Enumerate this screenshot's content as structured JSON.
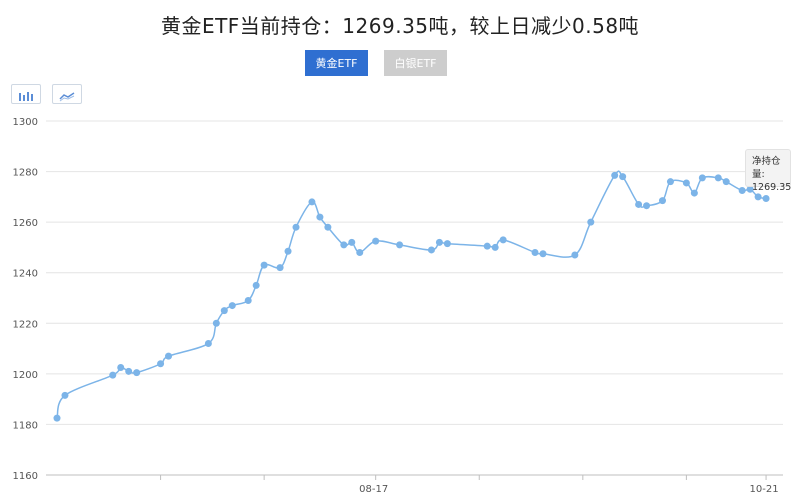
{
  "title": "黄金ETF当前持仓：1269.35吨，较上日减少0.58吨",
  "tabs": [
    {
      "label": "黄金ETF",
      "active": true,
      "color": "#2f6fd1"
    },
    {
      "label": "白银ETF",
      "active": false,
      "color": "#cdcdcd"
    }
  ],
  "view_toggle": {
    "bar_icon": "bar-chart-icon",
    "line_icon": "line-chart-icon"
  },
  "tooltip": {
    "label": "净持仓量:",
    "value": "1269.35"
  },
  "chart_data": {
    "type": "line",
    "ylim": [
      1160,
      1300
    ],
    "yticks": [
      1160,
      1180,
      1200,
      1220,
      1240,
      1260,
      1280,
      1300
    ],
    "xtick_labels": [
      "08-17",
      "10-21"
    ],
    "line_color": "#7cb4e8",
    "grid": true,
    "series": [
      {
        "x": [
          0,
          1,
          7,
          8,
          9,
          10,
          13,
          14,
          19,
          20,
          21,
          22,
          24,
          25,
          26,
          28,
          29,
          30,
          32,
          33,
          34,
          36,
          37,
          38,
          40,
          43,
          47,
          48,
          49,
          54,
          55,
          56,
          60,
          61,
          65,
          67,
          70,
          71,
          73,
          74,
          76,
          77,
          79,
          80,
          81,
          83,
          84,
          86,
          87,
          88,
          89
        ],
        "values": [
          1182.5,
          1191.5,
          1199.5,
          1202.5,
          1201.0,
          1200.5,
          1204.0,
          1207.0,
          1212.0,
          1220.0,
          1225.0,
          1227.0,
          1229.0,
          1235.0,
          1243.0,
          1242.0,
          1248.5,
          1258.0,
          1268.0,
          1262.0,
          1258.0,
          1251.0,
          1252.0,
          1248.0,
          1252.5,
          1251.0,
          1249.0,
          1252.0,
          1251.5,
          1250.5,
          1250.0,
          1253.0,
          1248.0,
          1247.5,
          1247.0,
          1260.0,
          1278.5,
          1278.0,
          1267.0,
          1266.5,
          1268.5,
          1276.0,
          1275.5,
          1271.5,
          1277.5,
          1277.5,
          1276.0,
          1272.5,
          1273.0,
          1270.0,
          1269.35
        ]
      }
    ]
  }
}
